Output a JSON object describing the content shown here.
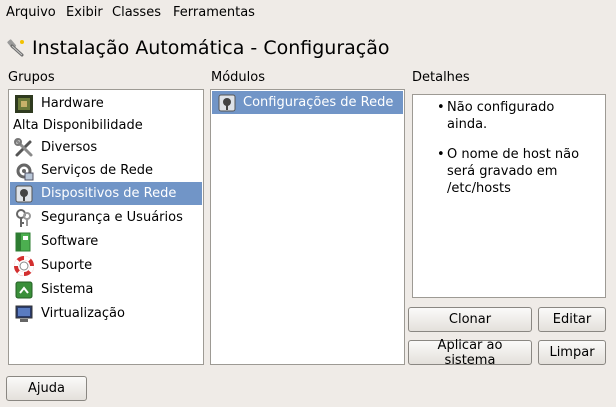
{
  "menubar": {
    "items": [
      {
        "label": "Arquivo"
      },
      {
        "label": "Exibir"
      },
      {
        "label": "Classes"
      },
      {
        "label": "Ferramentas"
      }
    ]
  },
  "window": {
    "title": "Instalação Automática - Configuração",
    "icon": "wrench-wand-icon"
  },
  "groups": {
    "label": "Grupos",
    "items": [
      {
        "label": "Hardware",
        "icon": "chip-icon"
      },
      {
        "label": "Alta Disponibilidade",
        "icon": ""
      },
      {
        "label": "Diversos",
        "icon": "tools-icon"
      },
      {
        "label": "Serviços de Rede",
        "icon": "network-services-icon"
      },
      {
        "label": "Dispositivos de Rede",
        "icon": "network-device-icon",
        "selected": true
      },
      {
        "label": "Segurança e Usuários",
        "icon": "keys-icon"
      },
      {
        "label": "Software",
        "icon": "software-icon"
      },
      {
        "label": "Suporte",
        "icon": "lifebuoy-icon"
      },
      {
        "label": "Sistema",
        "icon": "system-icon"
      },
      {
        "label": "Virtualização",
        "icon": "monitor-icon"
      }
    ]
  },
  "modules": {
    "label": "Módulos",
    "items": [
      {
        "label": "Configurações de Rede",
        "icon": "network-device-icon",
        "selected": true
      }
    ]
  },
  "details": {
    "label": "Detalhes",
    "bullets": [
      "Não configurado ainda.",
      "O nome de host não será gravado em /etc/hosts"
    ]
  },
  "buttons": {
    "clonar": "Clonar",
    "editar": "Editar",
    "aplicar": "Aplicar ao sistema",
    "limpar": "Limpar",
    "ajuda": "Ajuda"
  },
  "colors": {
    "selection": "#7195c7",
    "background": "#efebe7"
  }
}
